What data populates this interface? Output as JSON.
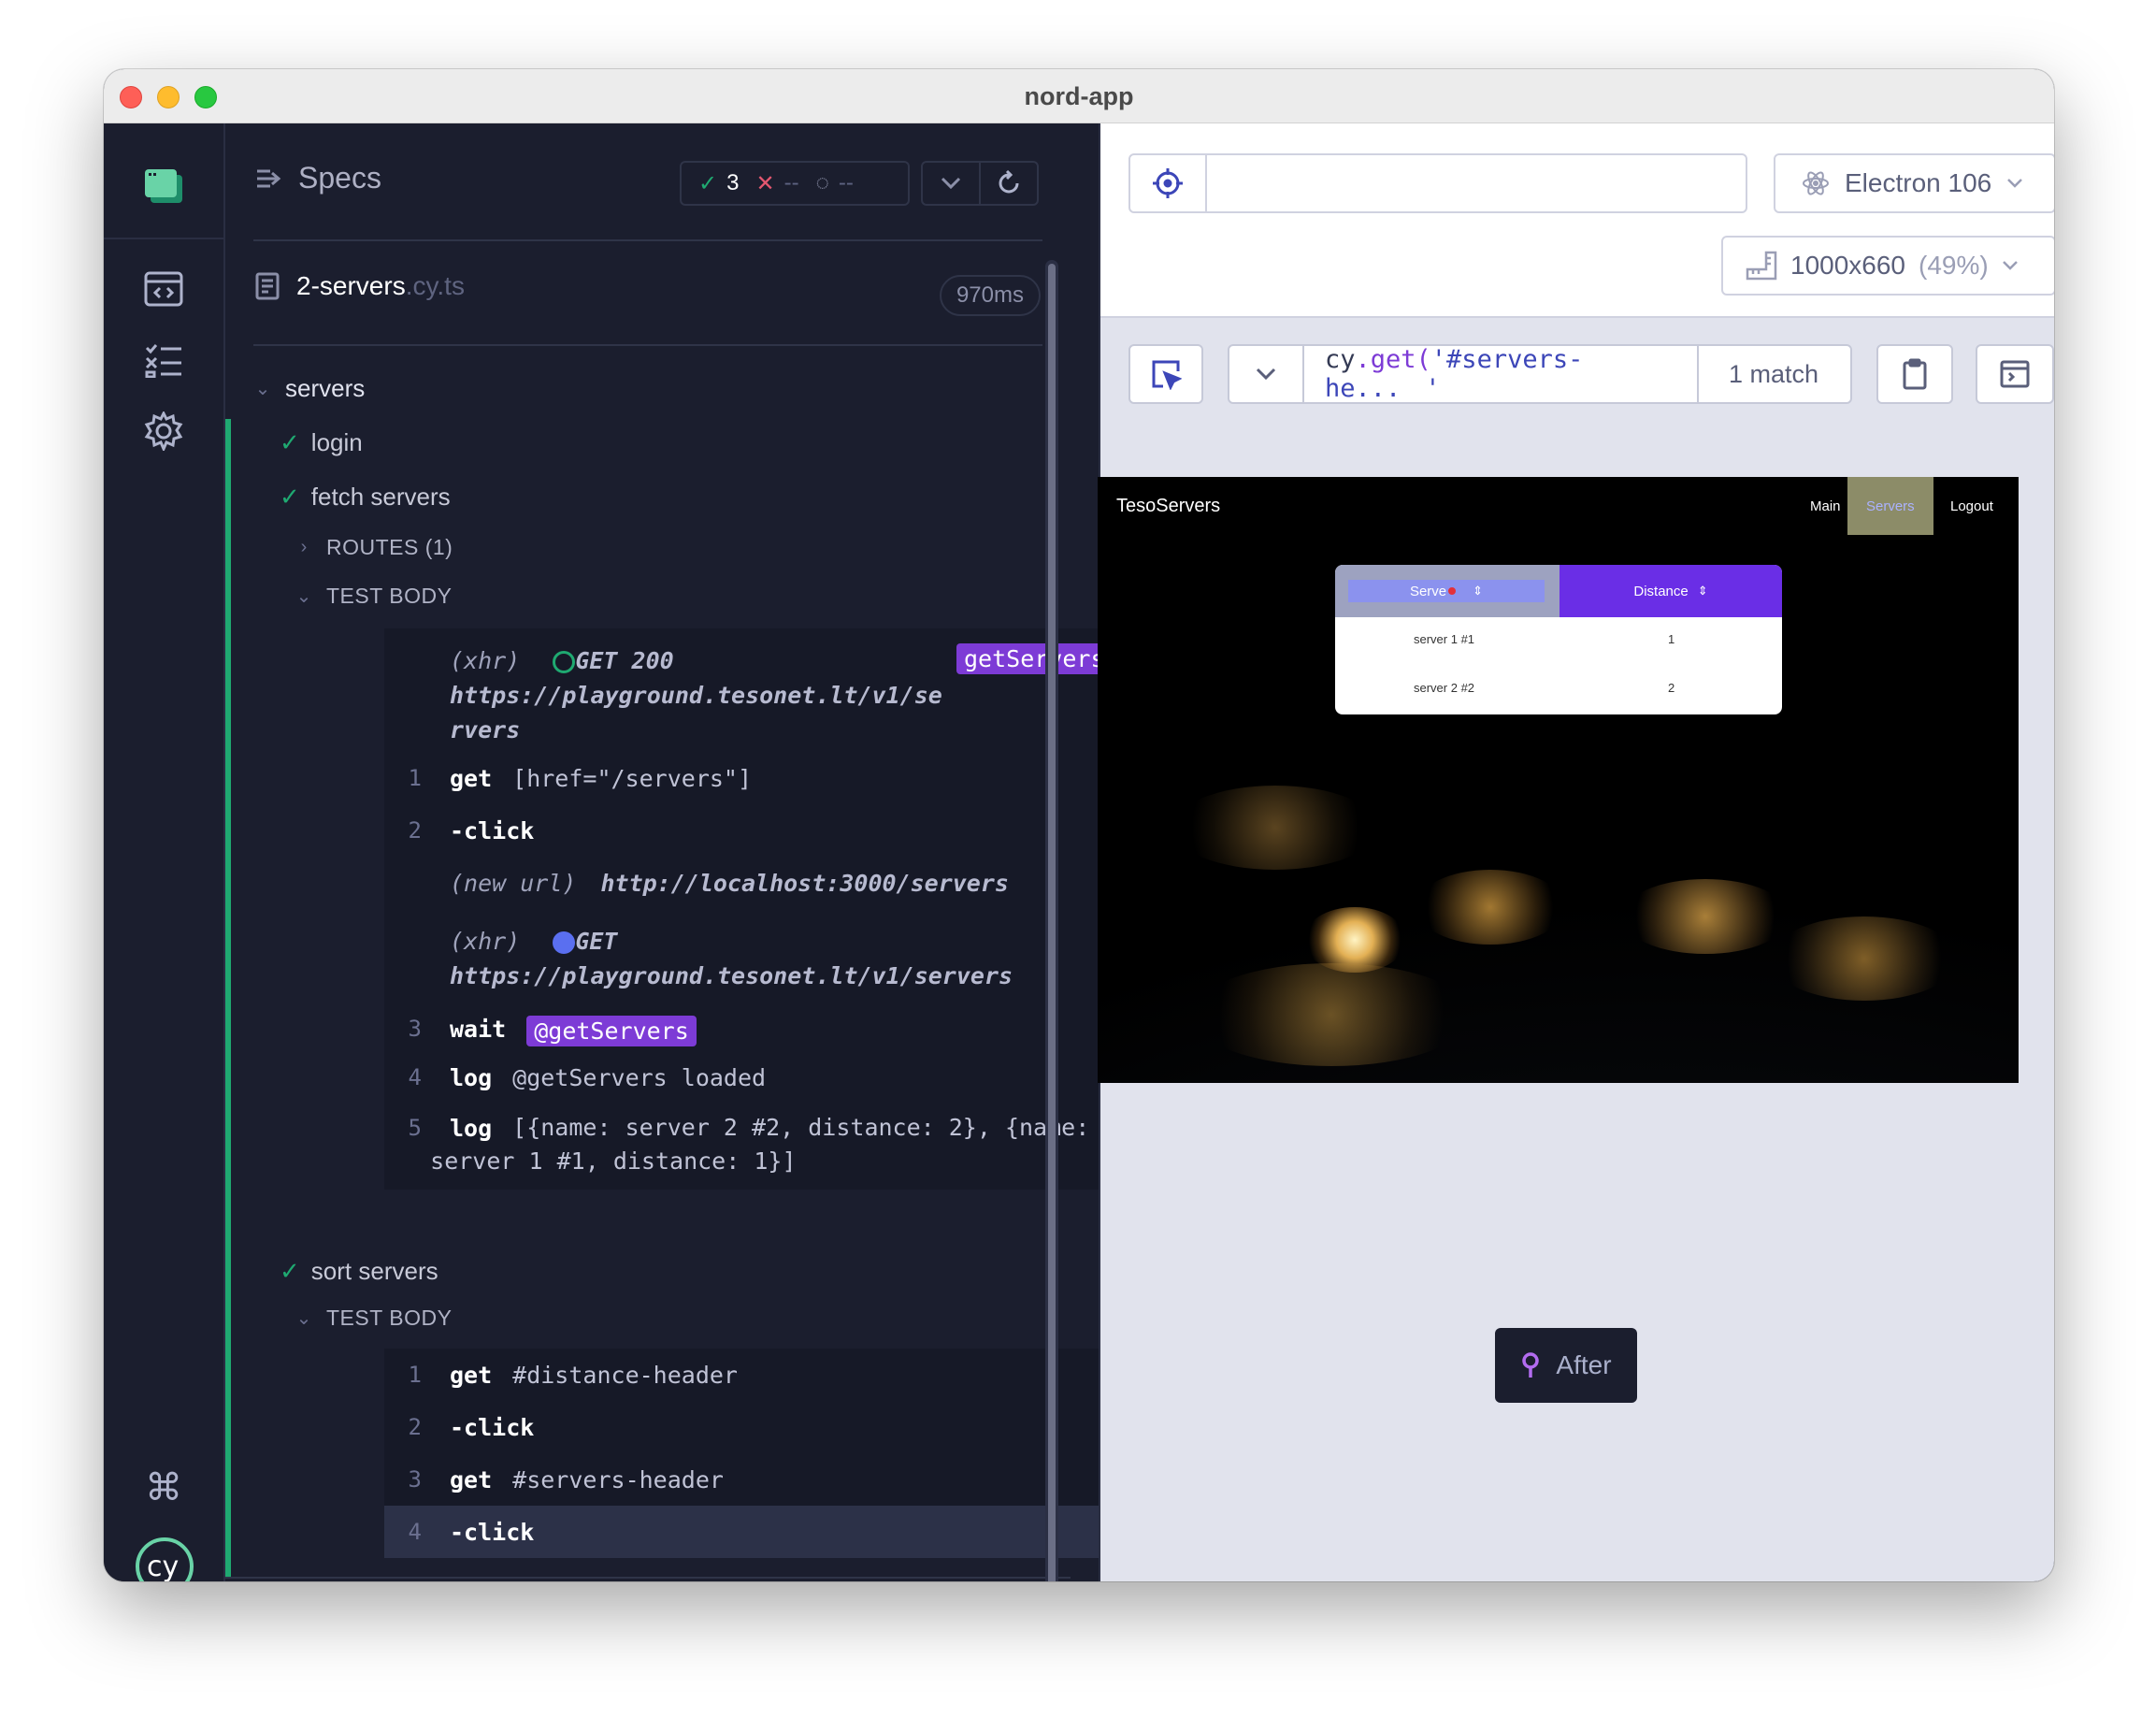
{
  "window": {
    "title": "nord-app"
  },
  "reporter": {
    "header": "Specs",
    "stats": {
      "passed": "3",
      "failed": "--",
      "pending": "--"
    },
    "spec": {
      "name": "2-servers",
      "ext": ".cy.ts",
      "duration": "970ms"
    },
    "suite": "servers",
    "tests": {
      "login": "login",
      "fetch": "fetch servers",
      "routes": "ROUTES (1)",
      "test_body": "TEST BODY",
      "sort": "sort servers",
      "test_body_2": "TEST BODY"
    },
    "fetch_commands": {
      "xhr1_tag": "(xhr)",
      "xhr1_status": "GET 200",
      "xhr1_url_a": "https://playground.tesonet.lt/v1/se",
      "xhr1_url_b": "rvers",
      "xhr1_alias": "getServers",
      "c1_num": "1",
      "c1_name": "get",
      "c1_msg": "[href=\"/servers\"]",
      "c2_num": "2",
      "c2_name": "-click",
      "newurl_tag": "(new url)",
      "newurl": "http://localhost:3000/servers",
      "xhr2_tag": "(xhr)",
      "xhr2_status": "GET",
      "xhr2_url": "https://playground.tesonet.lt/v1/servers",
      "c3_num": "3",
      "c3_name": "wait",
      "c3_alias": "@getServers",
      "c4_num": "4",
      "c4_name": "log",
      "c4_msg": "@getServers loaded",
      "c5_num": "5",
      "c5_name": "log",
      "c5_msg_a": "[{name: server 2 #2, distance: 2}, {name:",
      "c5_msg_b": "server 1 #1, distance: 1}]"
    },
    "sort_commands": [
      {
        "num": "1",
        "name": "get",
        "msg": "#distance-header"
      },
      {
        "num": "2",
        "name": "-click",
        "msg": ""
      },
      {
        "num": "3",
        "name": "get",
        "msg": "#servers-header"
      },
      {
        "num": "4",
        "name": "-click",
        "msg": ""
      }
    ]
  },
  "aut": {
    "browser": "Electron 106",
    "viewport": "1000x660",
    "viewport_scale": "(49%)",
    "selector": {
      "prefix": "cy",
      "fn": ".get(",
      "arg": "'#servers-he...",
      "close": "'"
    },
    "match": "1 match",
    "snapshot_label": "After",
    "app": {
      "brand": "TesoServers",
      "nav": [
        "Main",
        "Servers",
        "Logout"
      ],
      "table": {
        "headers": [
          "Serve",
          "Distance"
        ],
        "rows": [
          [
            "server 1 #1",
            "1"
          ],
          [
            "server 2 #2",
            "2"
          ]
        ]
      }
    }
  },
  "colors": {
    "pass": "#1fa971",
    "fail": "#e45770",
    "accent": "#7d3bd6",
    "indigo": "#3c46b8"
  }
}
